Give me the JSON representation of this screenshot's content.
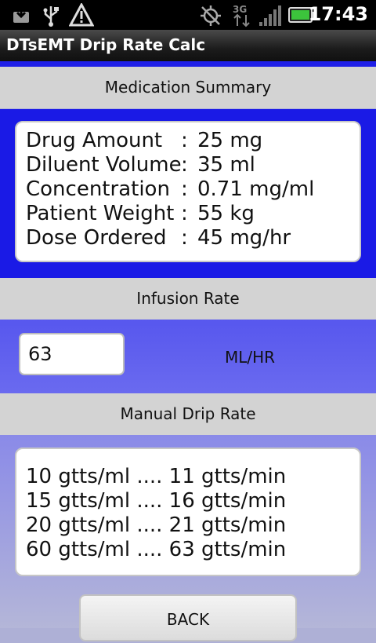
{
  "status_bar": {
    "time": "17:43",
    "icons": [
      "download-icon",
      "usb-icon",
      "warning-icon",
      "gps-off-icon",
      "3g-icon",
      "signal-icon",
      "battery-icon"
    ],
    "network_label": "3G"
  },
  "app": {
    "title": "DTsEMT Drip Rate Calc"
  },
  "medication_summary": {
    "header": "Medication Summary",
    "rows": [
      {
        "label": "Drug Amount",
        "value": "25 mg"
      },
      {
        "label": "Diluent Volume",
        "value": "35 ml"
      },
      {
        "label": "Concentration",
        "value": "0.71 mg/ml"
      },
      {
        "label": "Patient Weight",
        "value": "55 kg"
      },
      {
        "label": "Dose Ordered",
        "value": "45 mg/hr"
      }
    ],
    "separator": ":"
  },
  "infusion_rate": {
    "header": "Infusion Rate",
    "value": "63",
    "unit": "ML/HR"
  },
  "manual_drip_rate": {
    "header": "Manual Drip Rate",
    "lines": [
      "10 gtts/ml .... 11 gtts/min",
      "15 gtts/ml .... 16 gtts/min",
      "20 gtts/ml .... 21 gtts/min",
      "60 gtts/ml .... 63 gtts/min"
    ]
  },
  "actions": {
    "back_label": "BACK"
  },
  "colors": {
    "accent_blue": "#1a1ae6",
    "header_gray": "#d3d3d3",
    "battery_green": "#3cc43c"
  }
}
